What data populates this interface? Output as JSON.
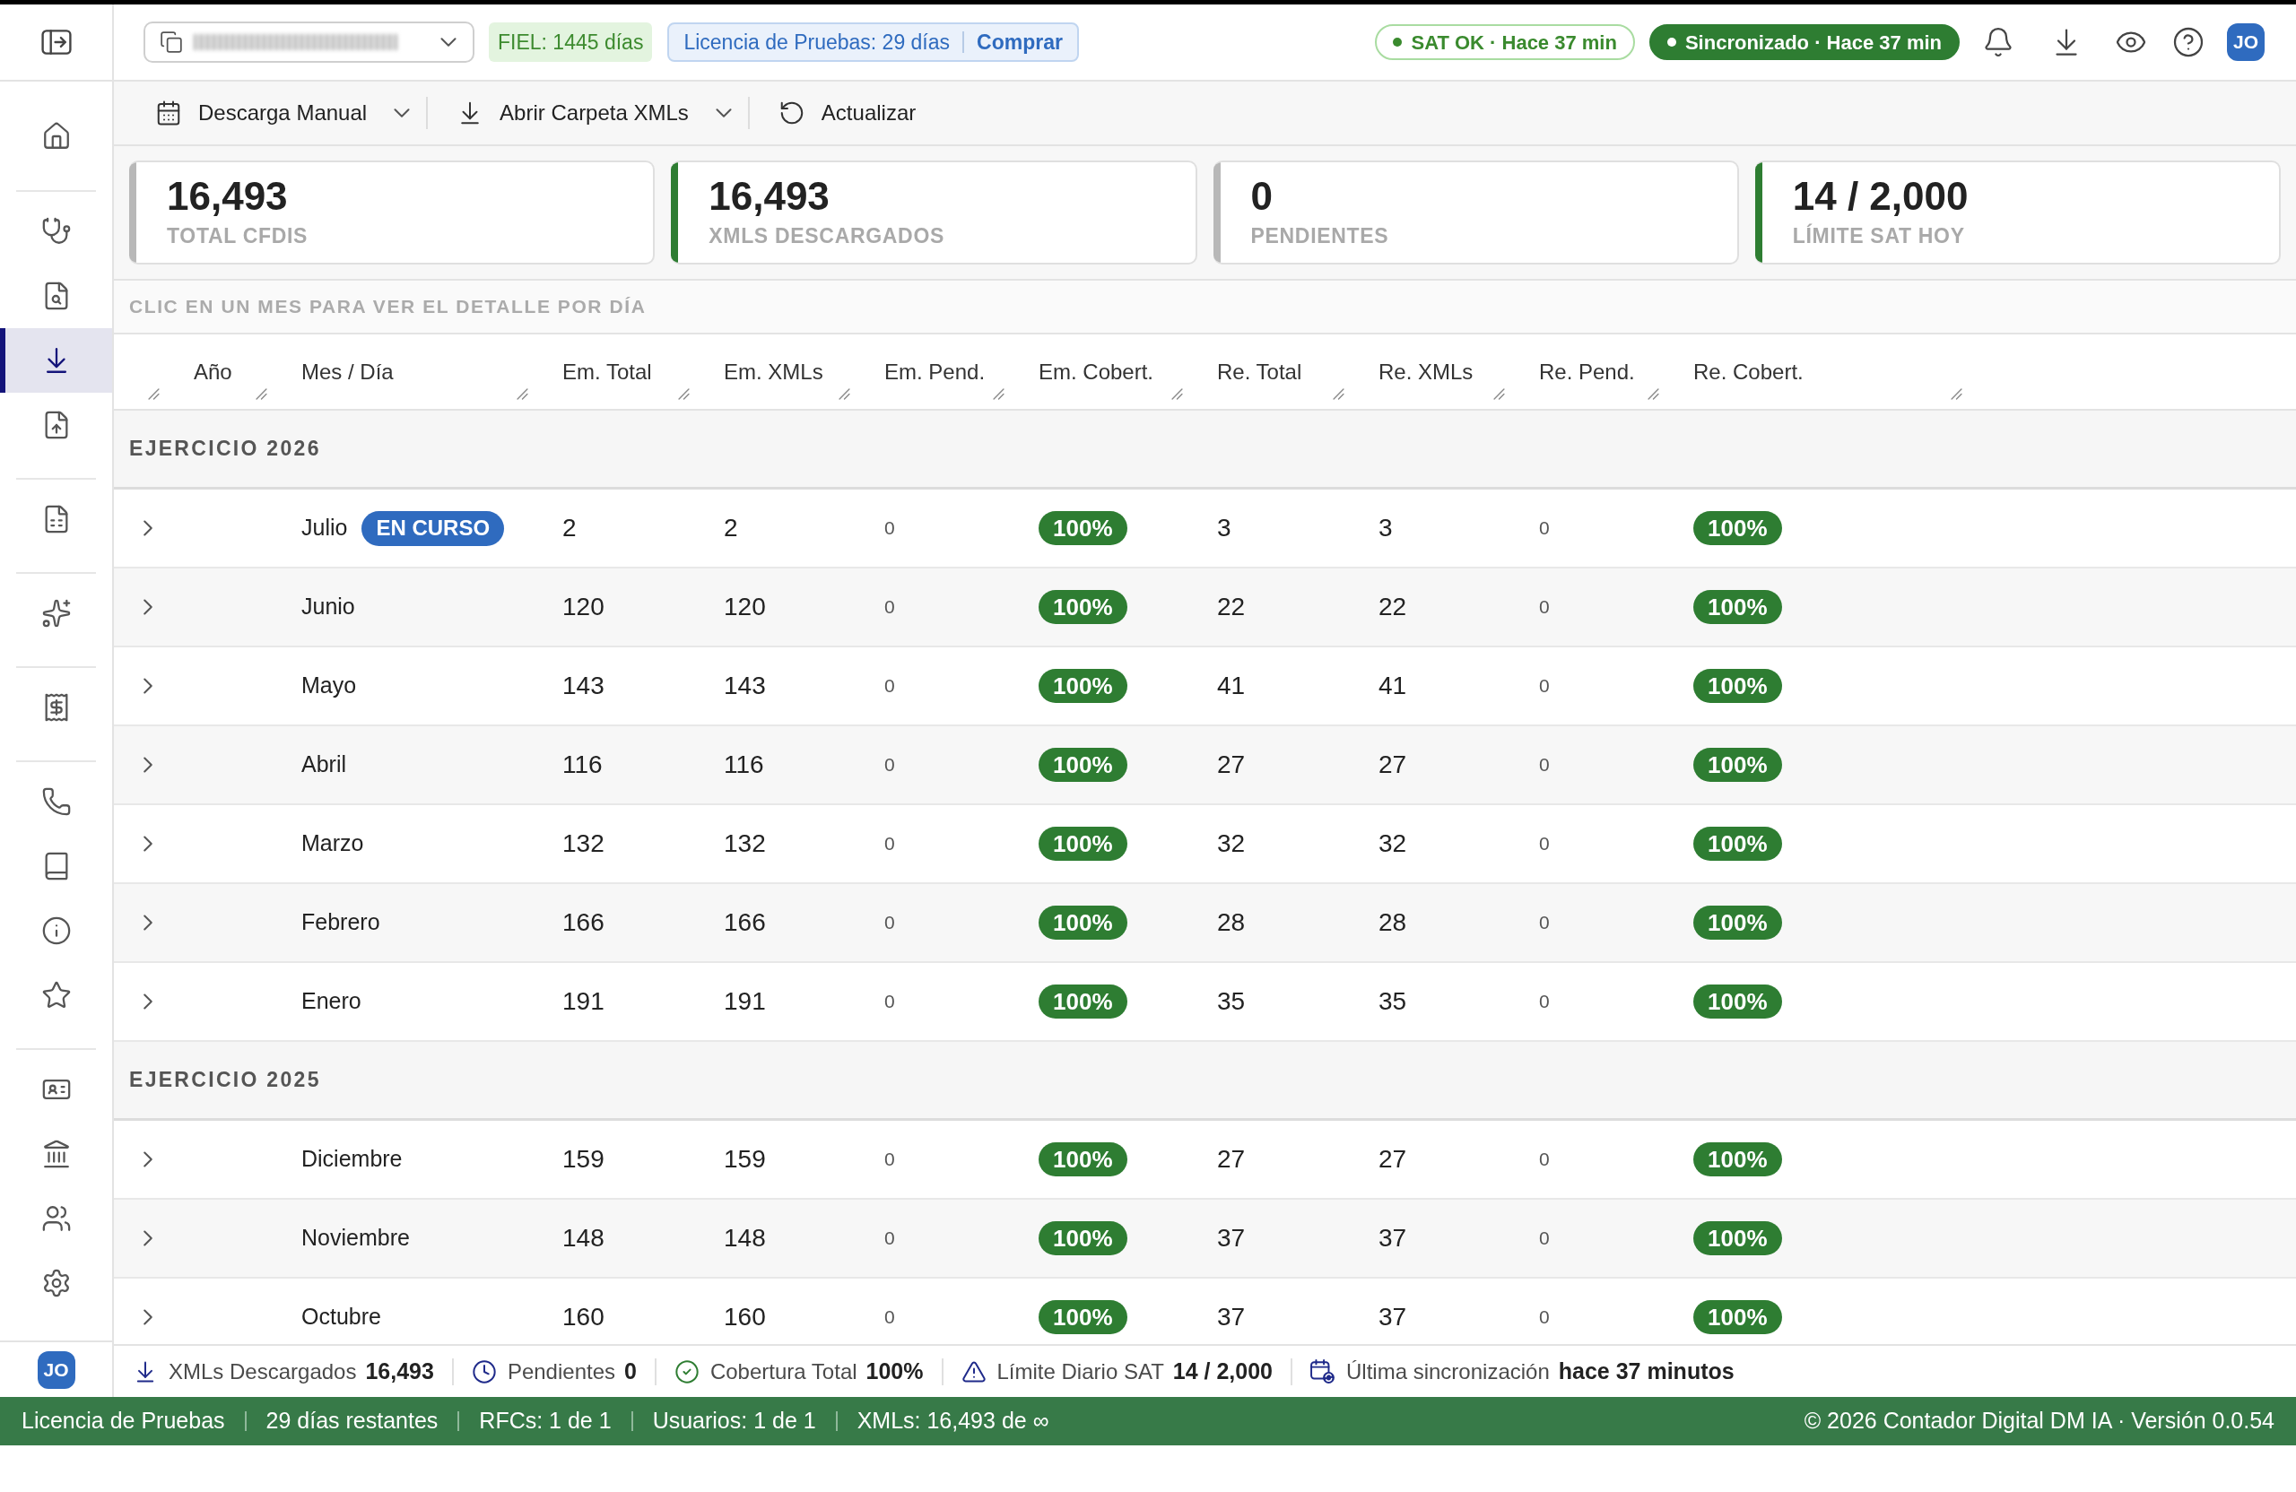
{
  "sidebar": {
    "sections": [
      {
        "items": [
          {
            "selected": false
          }
        ]
      },
      {
        "items": [
          {
            "selected": false
          },
          {
            "selected": false
          },
          {
            "selected": true
          },
          {
            "selected": false
          }
        ]
      },
      {
        "items": [
          {
            "selected": false
          }
        ]
      },
      {
        "items": [
          {
            "selected": false
          }
        ]
      },
      {
        "items": [
          {
            "selected": false
          }
        ]
      },
      {
        "items": [
          {
            "selected": false
          },
          {
            "selected": false
          },
          {
            "selected": false
          },
          {
            "selected": false
          }
        ]
      },
      {
        "items": [
          {
            "selected": false
          },
          {
            "selected": false
          },
          {
            "selected": false
          },
          {
            "selected": false
          }
        ]
      }
    ],
    "avatar": "JO"
  },
  "top_bar": {
    "company_selector": {
      "redacted": true
    },
    "fiel_badge": "FIEL: 1445 días",
    "license": {
      "text": "Licencia de Pruebas: 29 días",
      "action": "Comprar"
    },
    "status_pills": [
      {
        "kind": "outline",
        "text": "SAT OK · Hace 37 min"
      },
      {
        "kind": "solid",
        "text": "Sincronizado · Hace 37 min"
      }
    ],
    "avatar": "JO"
  },
  "toolbar": [
    {
      "label": "Descarga Manual",
      "has_menu": true
    },
    {
      "label": "Abrir Carpeta XMLs",
      "has_menu": true
    },
    {
      "label": "Actualizar",
      "has_menu": false
    }
  ],
  "stats": [
    {
      "value": "16,493",
      "label": "TOTAL CFDIS",
      "color": "#b8b8b8"
    },
    {
      "value": "16,493",
      "label": "XMLS DESCARGADOS",
      "color": "#2e7d32"
    },
    {
      "value": "0",
      "label": "PENDIENTES",
      "color": "#b8b8b8"
    },
    {
      "value": "14 / 2,000",
      "label": "LÍMITE SAT HOY",
      "color": "#2e7d32"
    }
  ],
  "table": {
    "hint": "CLIC EN UN MES PARA VER EL DETALLE POR DÍA",
    "columns": [
      "Año",
      "Mes / Día",
      "Em. Total",
      "Em. XMLs",
      "Em. Pend.",
      "Em. Cobert.",
      "Re. Total",
      "Re. XMLs",
      "Re. Pend.",
      "Re. Cobert."
    ],
    "groups": [
      {
        "title": "EJERCICIO 2026",
        "rows": [
          {
            "month": "Julio",
            "badge": "EN CURSO",
            "expanded": false,
            "em_total": "2",
            "em_xmls": "2",
            "em_pend": "0",
            "em_cobert": "100%",
            "re_total": "3",
            "re_xmls": "3",
            "re_pend": "0",
            "re_cobert": "100%"
          },
          {
            "month": "Junio",
            "expanded": false,
            "em_total": "120",
            "em_xmls": "120",
            "em_pend": "0",
            "em_cobert": "100%",
            "re_total": "22",
            "re_xmls": "22",
            "re_pend": "0",
            "re_cobert": "100%"
          },
          {
            "month": "Mayo",
            "expanded": false,
            "em_total": "143",
            "em_xmls": "143",
            "em_pend": "0",
            "em_cobert": "100%",
            "re_total": "41",
            "re_xmls": "41",
            "re_pend": "0",
            "re_cobert": "100%"
          },
          {
            "month": "Abril",
            "expanded": false,
            "em_total": "116",
            "em_xmls": "116",
            "em_pend": "0",
            "em_cobert": "100%",
            "re_total": "27",
            "re_xmls": "27",
            "re_pend": "0",
            "re_cobert": "100%"
          },
          {
            "month": "Marzo",
            "expanded": false,
            "em_total": "132",
            "em_xmls": "132",
            "em_pend": "0",
            "em_cobert": "100%",
            "re_total": "32",
            "re_xmls": "32",
            "re_pend": "0",
            "re_cobert": "100%"
          },
          {
            "month": "Febrero",
            "expanded": false,
            "em_total": "166",
            "em_xmls": "166",
            "em_pend": "0",
            "em_cobert": "100%",
            "re_total": "28",
            "re_xmls": "28",
            "re_pend": "0",
            "re_cobert": "100%"
          },
          {
            "month": "Enero",
            "expanded": false,
            "em_total": "191",
            "em_xmls": "191",
            "em_pend": "0",
            "em_cobert": "100%",
            "re_total": "35",
            "re_xmls": "35",
            "re_pend": "0",
            "re_cobert": "100%"
          }
        ]
      },
      {
        "title": "EJERCICIO 2025",
        "rows": [
          {
            "month": "Diciembre",
            "expanded": false,
            "em_total": "159",
            "em_xmls": "159",
            "em_pend": "0",
            "em_cobert": "100%",
            "re_total": "27",
            "re_xmls": "27",
            "re_pend": "0",
            "re_cobert": "100%"
          },
          {
            "month": "Noviembre",
            "expanded": false,
            "em_total": "148",
            "em_xmls": "148",
            "em_pend": "0",
            "em_cobert": "100%",
            "re_total": "37",
            "re_xmls": "37",
            "re_pend": "0",
            "re_cobert": "100%"
          },
          {
            "month": "Octubre",
            "expanded": false,
            "em_total": "160",
            "em_xmls": "160",
            "em_pend": "0",
            "em_cobert": "100%",
            "re_total": "37",
            "re_xmls": "37",
            "re_pend": "0",
            "re_cobert": "100%"
          }
        ]
      }
    ]
  },
  "summary": [
    {
      "label": "XMLs Descargados",
      "value": "16,493"
    },
    {
      "label": "Pendientes",
      "value": "0"
    },
    {
      "label": "Cobertura Total",
      "value": "100%"
    },
    {
      "label": "Límite Diario SAT",
      "value": "14 / 2,000"
    },
    {
      "label": "Última sincronización",
      "value": "hace 37 minutos"
    }
  ],
  "status_bar": {
    "left": [
      "Licencia de Pruebas",
      "29 días restantes",
      "RFCs: 1 de 1",
      "Usuarios: 1 de 1",
      "XMLs: 16,493 de ∞"
    ],
    "right": "© 2026 Contador Digital DM IA · Versión 0.0.54"
  }
}
